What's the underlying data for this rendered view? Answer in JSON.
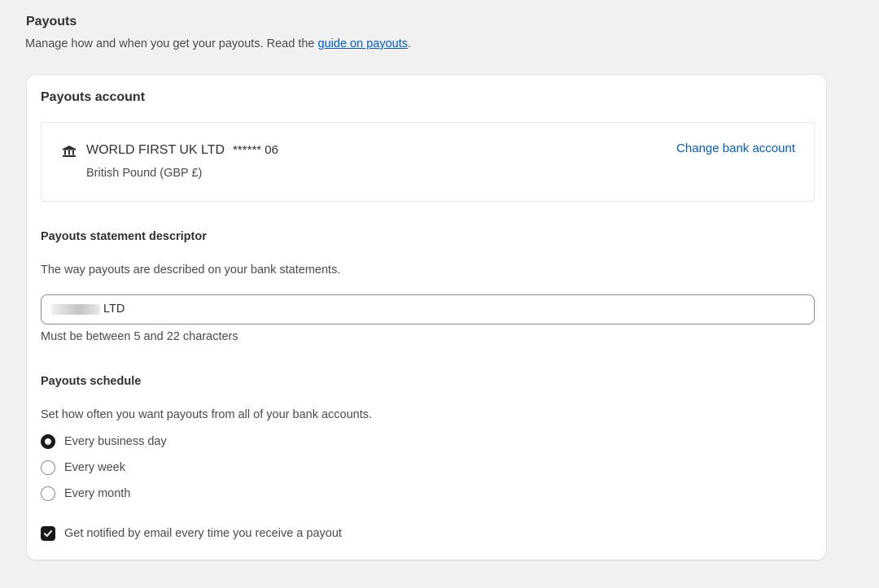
{
  "header": {
    "title": "Payouts",
    "description_prefix": "Manage how and when you get your payouts. Read the ",
    "guide_link": "guide on payouts",
    "description_suffix": "."
  },
  "account": {
    "title": "Payouts account",
    "bank_icon": "bank-icon",
    "bank_name": "WORLD FIRST UK LTD",
    "account_mask": "****** 06",
    "currency": "British Pound (GBP £)",
    "change_link": "Change bank account"
  },
  "descriptor": {
    "title": "Payouts statement descriptor",
    "description": "The way payouts are described on your bank statements.",
    "value_visible": "LTD",
    "help": "Must be between 5 and 22 characters"
  },
  "schedule": {
    "title": "Payouts schedule",
    "description": "Set how often you want payouts from all of your bank accounts.",
    "options": [
      "Every business day",
      "Every week",
      "Every month"
    ],
    "selected": "Every business day",
    "notify_label": "Get notified by email every time you receive a payout",
    "notify_checked": true
  },
  "colors": {
    "link": "#005bd3",
    "background": "#f1f1f1",
    "card": "#ffffff",
    "control_dark": "#1a1a1a"
  }
}
